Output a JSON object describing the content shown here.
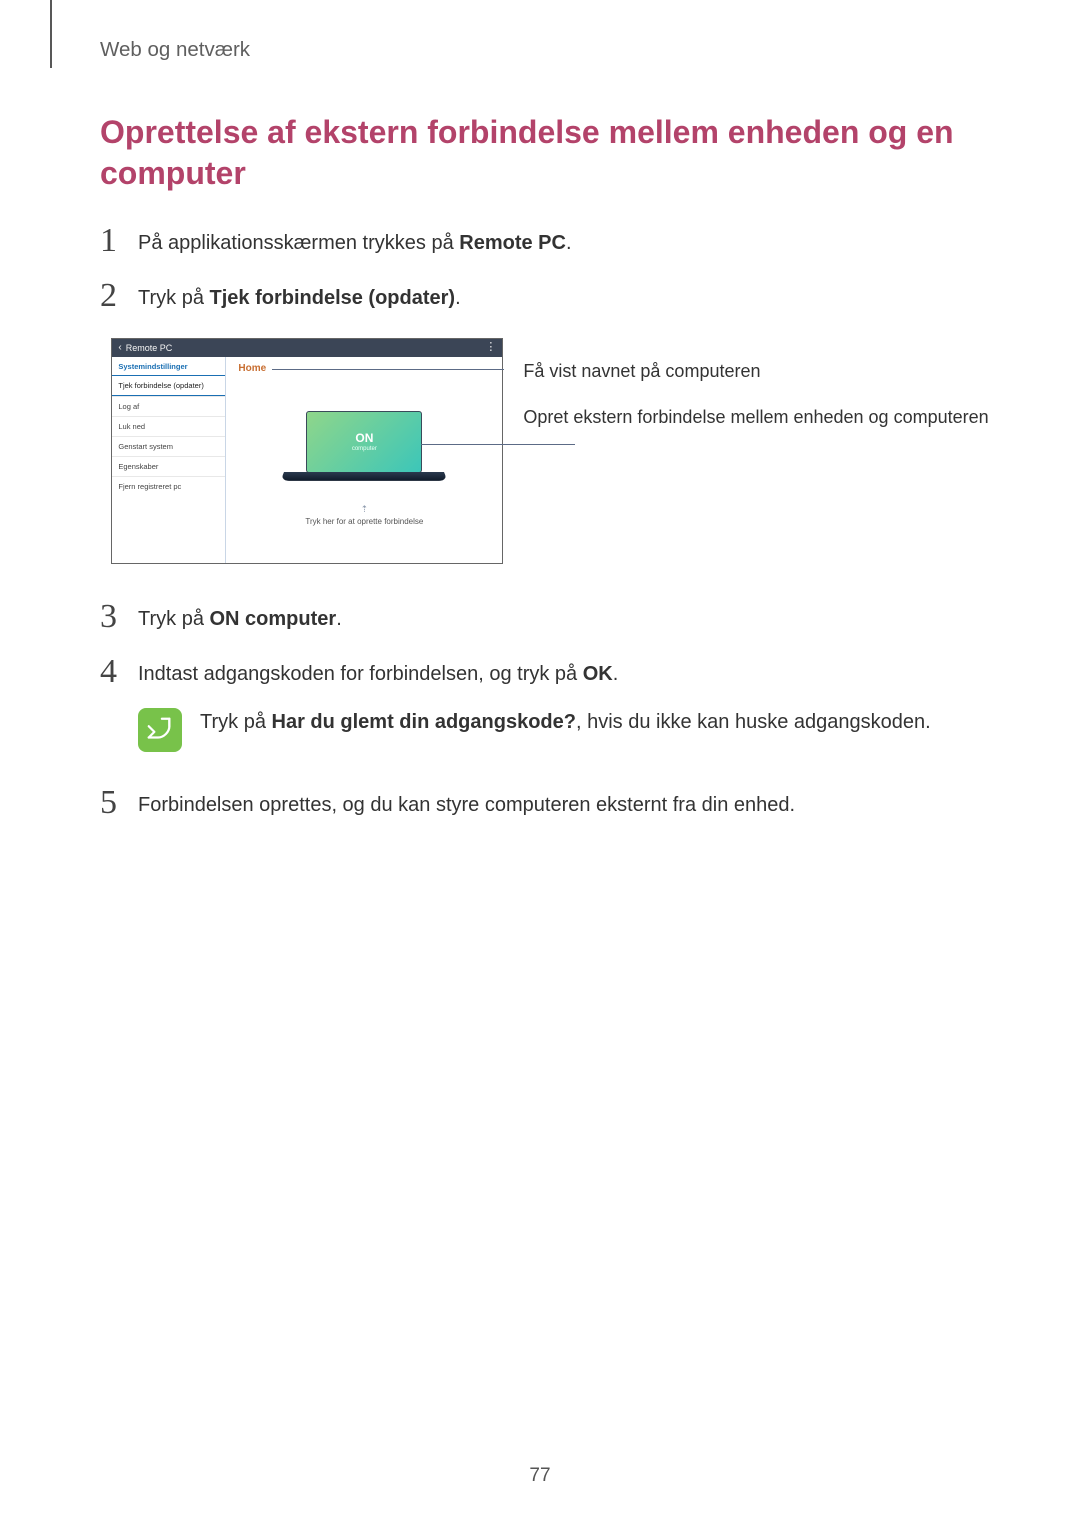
{
  "header": {
    "section": "Web og netværk"
  },
  "title": "Oprettelse af ekstern forbindelse mellem enheden og en computer",
  "steps": {
    "s1": {
      "num": "1",
      "pre": "På applikationsskærmen trykkes på ",
      "bold": "Remote PC",
      "post": "."
    },
    "s2": {
      "num": "2",
      "pre": "Tryk på ",
      "bold": "Tjek forbindelse (opdater)",
      "post": "."
    },
    "s3": {
      "num": "3",
      "pre": "Tryk på ",
      "bold": "ON computer",
      "post": "."
    },
    "s4": {
      "num": "4",
      "pre": "Indtast adgangskoden for forbindelsen, og tryk på ",
      "bold": "OK",
      "post": "."
    },
    "s5": {
      "num": "5",
      "text": "Forbindelsen oprettes, og du kan styre computeren eksternt fra din enhed."
    }
  },
  "note": {
    "pre": "Tryk på ",
    "bold": "Har du glemt din adgangskode?",
    "post": ", hvis du ikke kan huske adgangskoden."
  },
  "screenshot": {
    "titlebar": {
      "back": "‹",
      "title": "Remote PC",
      "menu": "⋮"
    },
    "sidebar": {
      "header": "Systemindstillinger",
      "items": [
        "Tjek forbindelse (opdater)",
        "Log af",
        "Luk ned",
        "Genstart system",
        "Egenskaber",
        "Fjern registreret pc"
      ]
    },
    "main": {
      "home": "Home",
      "screen_on": "ON",
      "screen_sub": "computer",
      "hint_arrow": "⇡",
      "hint_text": "Tryk her for at oprette forbindelse"
    }
  },
  "annotations": {
    "a1": "Få vist navnet på computeren",
    "a2": "Opret ekstern forbindelse mellem enheden og computeren"
  },
  "page_number": "77"
}
